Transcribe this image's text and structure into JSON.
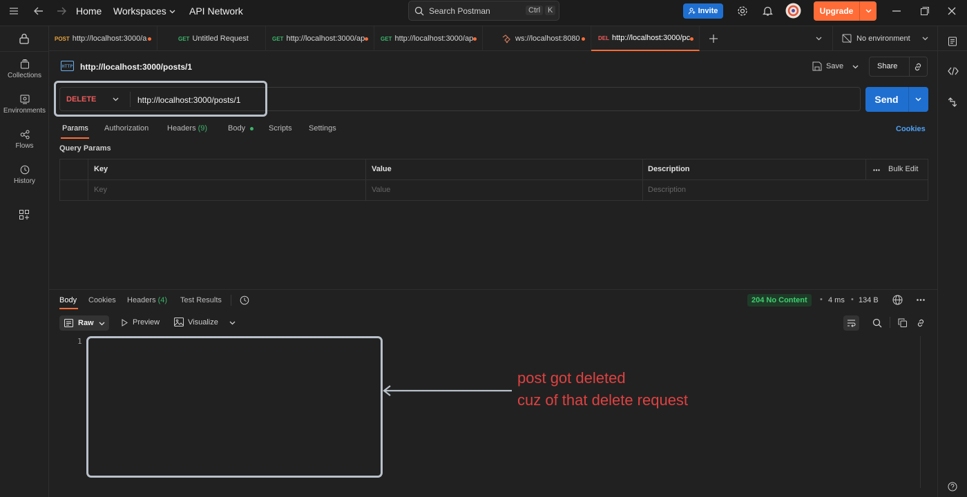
{
  "topbar": {
    "home": "Home",
    "workspaces": "Workspaces",
    "api_network": "API Network",
    "search_placeholder": "Search Postman",
    "kbd_ctrl": "Ctrl",
    "kbd_k": "K",
    "invite": "Invite",
    "upgrade": "Upgrade"
  },
  "rail": {
    "collections": "Collections",
    "environments": "Environments",
    "flows": "Flows",
    "history": "History"
  },
  "tabs": [
    {
      "method": "POST",
      "title": "http://localhost:3000/a",
      "color": "#e8a33d"
    },
    {
      "method": "GET",
      "title": "Untitled Request",
      "color": "#3bb56a"
    },
    {
      "method": "GET",
      "title": "http://localhost:3000/ap",
      "color": "#3bb56a"
    },
    {
      "method": "GET",
      "title": "http://localhost:3000/ap",
      "color": "#3bb56a"
    },
    {
      "method": "",
      "title": "ws://localhost:8080",
      "color": "#bdbdbd"
    },
    {
      "method": "DEL",
      "title": "http://localhost:3000/pc",
      "color": "#f05b5b"
    }
  ],
  "environment": "No environment",
  "request": {
    "name": "http://localhost:3000/posts/1",
    "save": "Save",
    "share": "Share",
    "method": "DELETE",
    "url": "http://localhost:3000/posts/1",
    "send": "Send"
  },
  "req_tabs": {
    "params": "Params",
    "authorization": "Authorization",
    "headers": "Headers",
    "headers_count": "(9)",
    "body": "Body",
    "scripts": "Scripts",
    "settings": "Settings",
    "cookies": "Cookies"
  },
  "query": {
    "title": "Query Params",
    "col_key": "Key",
    "col_value": "Value",
    "col_description": "Description",
    "bulk_edit": "Bulk Edit",
    "ph_key": "Key",
    "ph_value": "Value",
    "ph_description": "Description"
  },
  "response": {
    "body": "Body",
    "cookies": "Cookies",
    "headers": "Headers",
    "headers_count": "(4)",
    "test_results": "Test Results",
    "status": "204 No Content",
    "time": "4 ms",
    "size": "134 B",
    "raw": "Raw",
    "preview": "Preview",
    "visualize": "Visualize",
    "line_number": "1"
  },
  "annotation": {
    "line1": "post got deleted",
    "line2": "cuz of that delete request"
  },
  "colors": {
    "accent": "#ff6c37",
    "send": "#1f6fd0",
    "delete_method": "#f05b5b",
    "annotation": "#e04141"
  }
}
